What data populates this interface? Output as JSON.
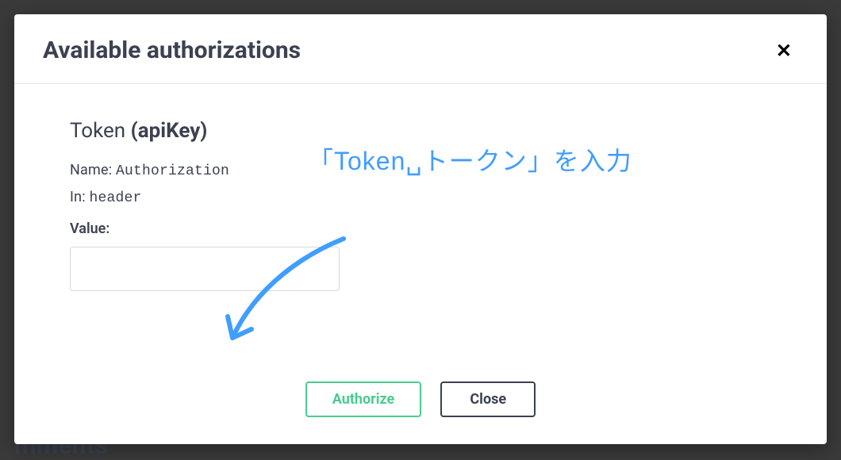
{
  "modal": {
    "title": "Available authorizations",
    "auth": {
      "name_thin": "Token ",
      "name_bold": "(apiKey)",
      "name_label": "Name: ",
      "name_value": "Authorization",
      "in_label": "In: ",
      "in_value": "header",
      "value_label": "Value:",
      "value_input": ""
    },
    "buttons": {
      "authorize": "Authorize",
      "close": "Close"
    }
  },
  "annotation": {
    "text": "「Token␣トークン」を入力"
  },
  "background": {
    "fragment": "mments"
  }
}
